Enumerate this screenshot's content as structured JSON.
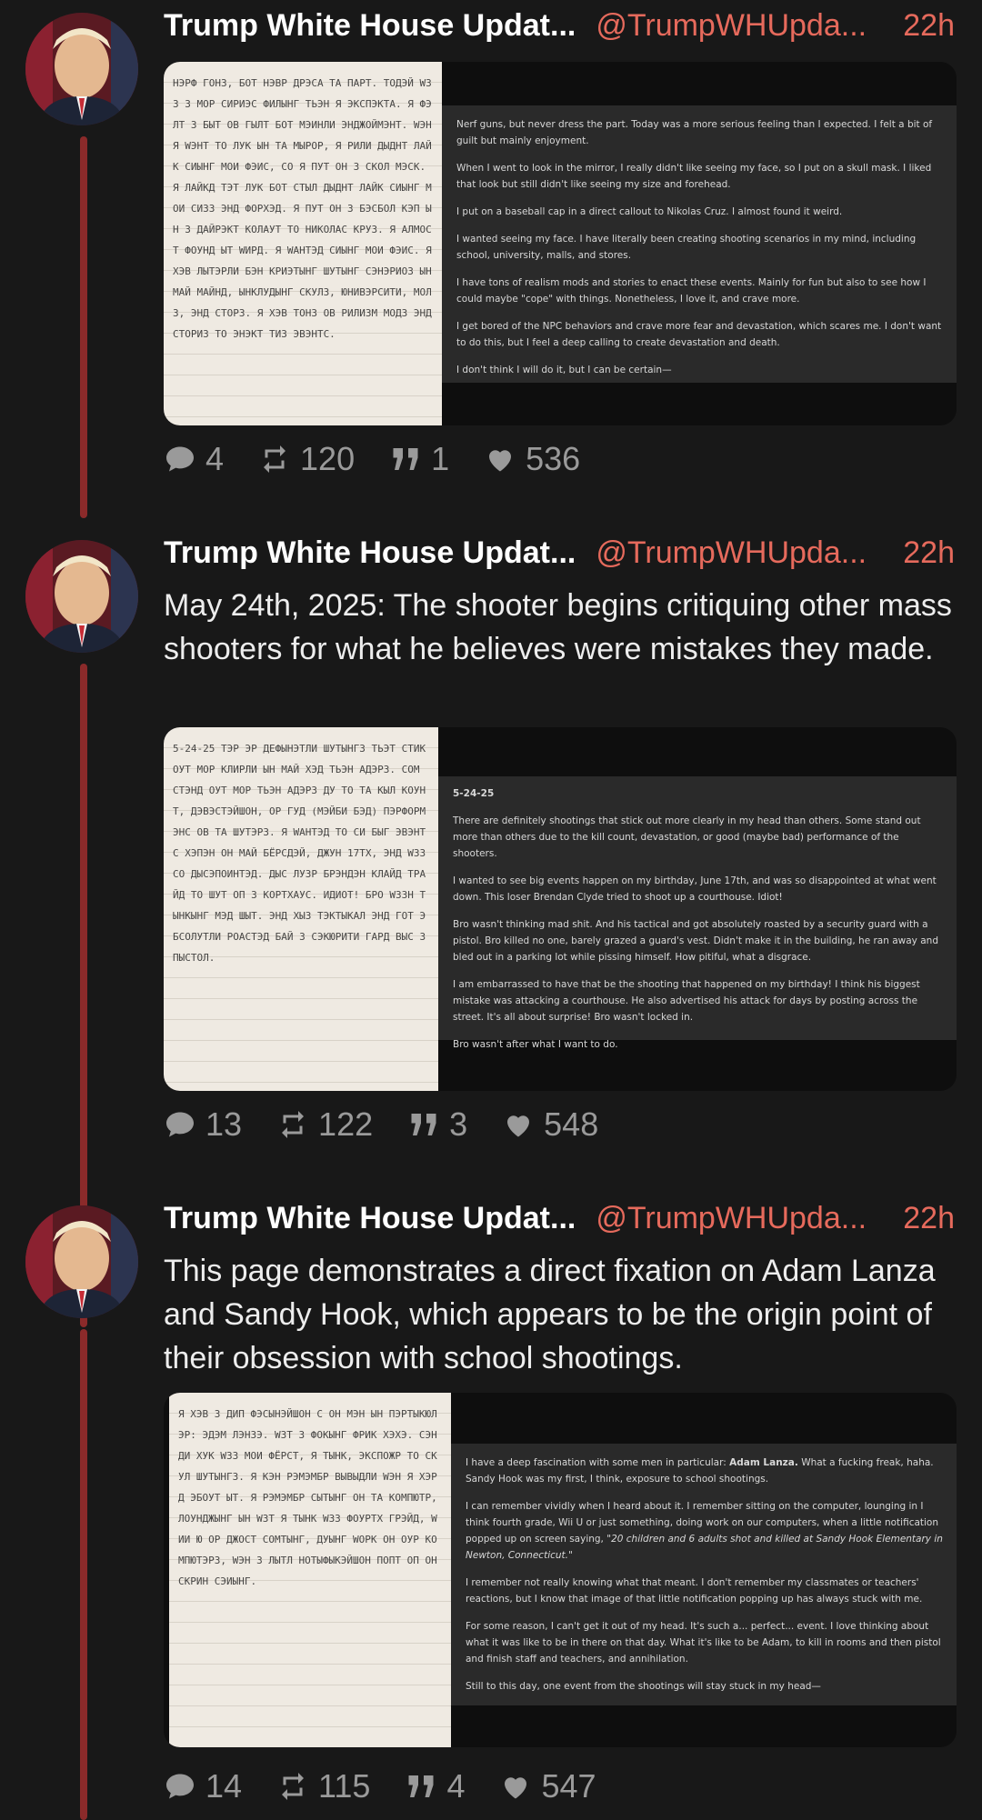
{
  "posts": [
    {
      "name": "Trump White House Updat...",
      "handle": "@TrumpWHUpda...",
      "time": "22h",
      "text": "",
      "note_scribble": "НЭРФ ГОНЗ, БОТ НЭВР ДРЭСА ТА ПАРТ. ТОДЭЙ WЗЗ З МОР СИРИЭС ФИЛЫНГ ТЬЭН Я ЭКСПЭКТА. Я ФЭЛТ З БЫТ ОВ ГЫЛТ БОТ МЭИНЛИ ЭНДЖОЙМЭНТ. WЭН Я WЭНТ ТО ЛУК ЫН ТА МЫРОР, Я РИЛИ ДЫДНТ ЛАЙК СИЫНГ МОИ ФЭИС, СО Я ПУТ ОН З СКОЛ МЭСК. Я ЛАЙКД ТЭТ ЛУК БОТ СТЫЛ ДЫДНТ ЛАЙК СИЫНГ МОИ СИЗЗ ЭНД ФОРХЭД. Я ПУТ ОН З БЭСБОЛ КЭП ЫН З ДАЙРЭКТ КОЛАУТ ТО НИКОЛАС КРУЗ. Я АЛМОСТ ФОУНД ЫТ WИРД. Я WАНТЭД СИЫНГ МОИ ФЭИС. Я ХЭВ ЛЫТЭРЛИ БЭН КРИЭТЫНГ ШУТЫНГ СЭНЭРИОЗ ЫН МАЙ МАЙНД, ЫНКЛУДЫНГ СКУЛЗ, ЮНИВЭРСИТИ, МОЛЗ, ЭНД СТОРЗ. Я ХЭВ ТОНЗ ОВ РИЛИЗМ МОДЗ ЭНД СТОРИЗ ТО ЭНЭКТ ТИЗ ЭВЭНТС.",
      "panel": {
        "heading": "",
        "paragraphs": [
          "Nerf guns, but never dress the part. Today was a more serious feeling than I expected. I felt a bit of guilt but mainly enjoyment.",
          "When I went to look in the mirror, I really didn't like seeing my face, so I put on a skull mask. I liked that look but still didn't like seeing my size and forehead.",
          "I put on a baseball cap in a direct callout to Nikolas Cruz. I almost found it weird.",
          "I wanted seeing my face. I have literally been creating shooting scenarios in my mind, including school, university, malls, and stores.",
          "I have tons of realism mods and stories to enact these events. Mainly for fun but also to see how I could maybe \"cope\" with things. Nonetheless, I love it, and crave more.",
          "I get bored of the NPC behaviors and crave more fear and devastation, which scares me. I don't want to do this, but I feel a deep calling to create devastation and death.",
          "I don't think I will do it, but I can be certain—"
        ]
      },
      "stats": {
        "replies": "4",
        "reposts": "120",
        "quotes": "1",
        "likes": "536"
      }
    },
    {
      "name": "Trump White House Updat...",
      "handle": "@TrumpWHUpda...",
      "time": "22h",
      "text": "May 24th, 2025: The shooter begins critiquing other mass shooters for what he believes were mistakes they made.",
      "note_scribble": "5-24-25 ТЭР ЭР ДЕФЫНЭТЛИ ШУТЫНГЗ ТЬЭТ СТИК ОУТ МОР КЛИРЛИ ЫН МАЙ ХЭД ТЬЭН АДЭРЗ. СОМ СТЭНД ОУТ МОР ТЬЭН АДЭРЗ ДУ ТО ТА КЫЛ КОУНТ, ДЭВЭСТЭЙШОН, ОР ГУД (МЭЙБИ БЭД) ПЭРФОРМЭНС ОВ ТА ШУТЭРЗ. Я WАНТЭД ТО СИ БЫГ ЭВЭНТС ХЭПЭН ОН МАЙ БЁРСДЭЙ, ДЖУН 17ТХ, ЭНД WЗЗ СО ДЫСЭПОИНТЭД. ДЫС ЛУЗР БРЭНДЭН КЛАЙД ТРАЙД ТО ШУТ ОП З КОРТХАУС. ИДИОТ! БРО WЗЗН ТЫНКЫНГ МЭД ШЫТ. ЭНД ХЫЗ ТЭКТЫКАЛ ЭНД ГОТ ЭБСОЛУТЛИ РОАСТЭД БАЙ З СЭКЮРИТИ ГАРД ВЫС З ПЫСТОЛ.",
      "panel": {
        "heading": "5-24-25",
        "paragraphs": [
          "There are definitely shootings that stick out more clearly in my head than others. Some stand out more than others due to the kill count, devastation, or good (maybe bad) performance of the shooters.",
          "I wanted to see big events happen on my birthday, June 17th, and was so disappointed at what went down. This loser Brendan Clyde tried to shoot up a courthouse. Idiot!",
          "Bro wasn't thinking mad shit. And his tactical and got absolutely roasted by a security guard with a pistol. Bro killed no one, barely grazed a guard's vest. Didn't make it in the building, he ran away and bled out in a parking lot while pissing himself. How pitiful, what a disgrace.",
          "I am embarrassed to have that be the shooting that happened on my birthday! I think his biggest mistake was attacking a courthouse. He also advertised his attack for days by posting across the street. It's all about surprise! Bro wasn't locked in.",
          "Bro wasn't after what I want to do."
        ]
      },
      "stats": {
        "replies": "13",
        "reposts": "122",
        "quotes": "3",
        "likes": "548"
      }
    },
    {
      "name": "Trump White House Updat...",
      "handle": "@TrumpWHUpda...",
      "time": "22h",
      "text": "This page demonstrates a direct fixation on Adam Lanza and Sandy Hook, which appears to be the origin point of their obsession with school shootings.",
      "note_scribble": "Я ХЭВ З ДИП ФЭСЫНЭЙШОН С ОН МЭН ЫН ПЭРТЫКЮЛЭР: ЭДЭМ ЛЭНЗЭ. WЗТ З ФОКЫНГ ФРИК ХЭХЭ. СЭНДИ ХУК WЗЗ МОИ ФЁРСТ, Я ТЫНК, ЭКСПОЖР ТО СКУЛ ШУТЫНГЗ. Я КЭН РЭМЭМБР ВЫВЫДЛИ WЭН Я ХЭРД ЭБОУТ ЫТ. Я РЭМЭМБР СЫТЫНГ ОН ТА КОМПЮТР, ЛОУНДЖЫНГ ЫН WЗТ Я ТЫНК WЗЗ ФОУРТХ ГРЭЙД, WИИ Ю ОР ДЖОСТ СОМТЫНГ, ДУЫНГ WОРК ОН ОУР КОМПЮТЭРЗ, WЭН З ЛЫТЛ НОТЫФЫКЭЙШОН ПОПТ ОП ОН СКРИН СЭИЫНГ.",
      "panel": {
        "heading": "",
        "paragraphs_rich": [
          {
            "pre": "I have a deep fascination with some men in particular: ",
            "bold": "Adam Lanza.",
            "post": " What a fucking freak, haha. Sandy Hook was my first, I think, exposure to school shootings."
          },
          {
            "pre": "I can remember vividly when I heard about it. I remember sitting on the computer, lounging in I think fourth grade, Wii U or just something, doing work on our computers, when a little notification popped up on screen saying, ",
            "italic": "\"20 children and 6 adults shot and killed at Sandy Hook Elementary in Newton, Connecticut.\"",
            "post": ""
          },
          {
            "pre": "I remember not really knowing what that meant. I don't remember my classmates or teachers' reactions, but I know that image of that little notification popping up has always stuck with me.",
            "post": ""
          },
          {
            "pre": "For some reason, I can't get it out of my head. It's such a... perfect... event. I love thinking about what it was like to be in there on that day. What it's like to be Adam, to kill in rooms and then pistol and finish staff and teachers, and annihilation.",
            "post": ""
          },
          {
            "pre": "Still to this day, one event from the shootings will stay stuck in my head—",
            "post": ""
          }
        ]
      },
      "stats": {
        "replies": "14",
        "reposts": "115",
        "quotes": "4",
        "likes": "547"
      }
    }
  ],
  "colors": {
    "background": "#181818",
    "accent": "#e66a5c",
    "thread": "#8b2a2a",
    "muted": "#9a9a9a"
  },
  "icons": [
    "reply-icon",
    "repost-icon",
    "quote-icon",
    "like-icon"
  ]
}
